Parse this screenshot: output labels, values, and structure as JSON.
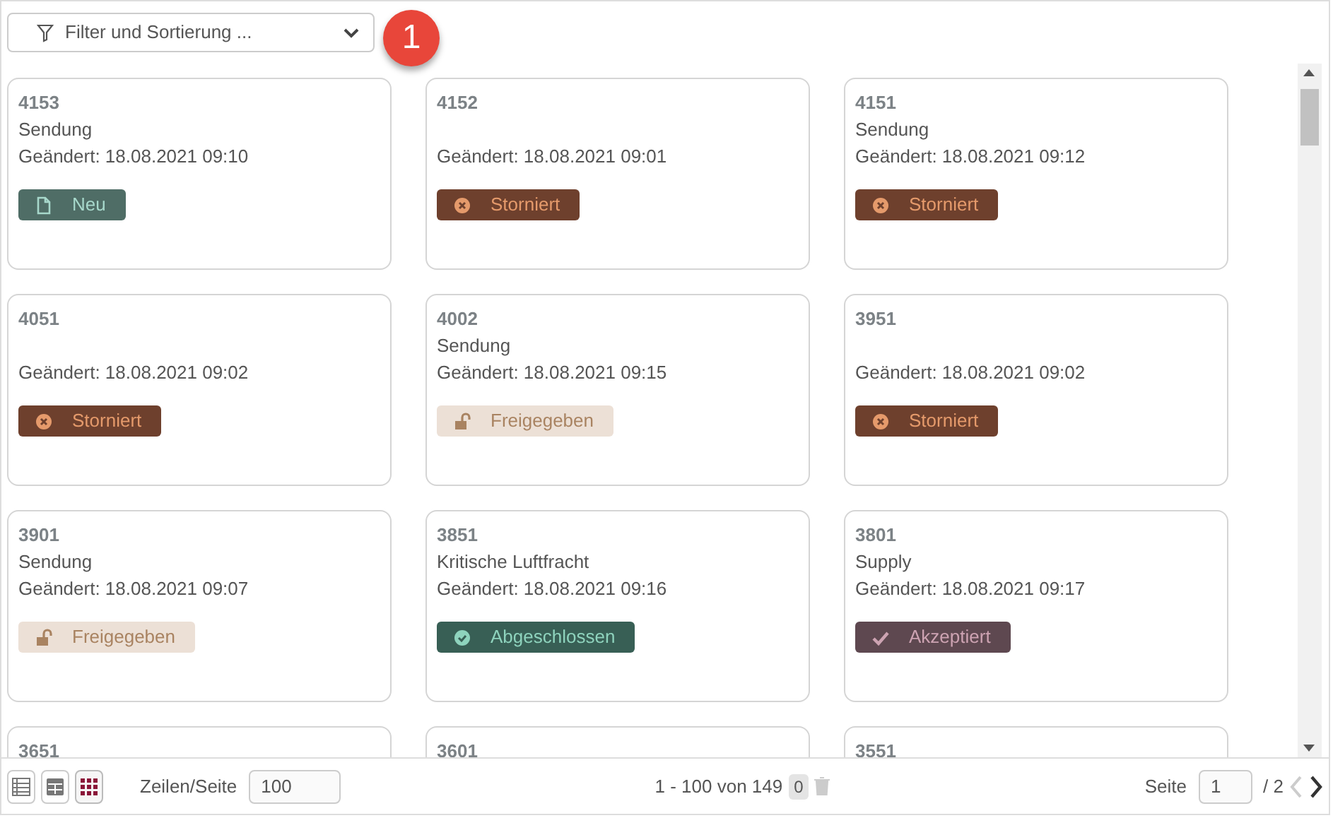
{
  "filter": {
    "label": "Filter und Sortierung ...",
    "badge": "1"
  },
  "cards": [
    {
      "number": "4153",
      "type": "Sendung",
      "changed": "Geändert: 18.08.2021 09:10",
      "status": {
        "kind": "new",
        "label": "Neu"
      }
    },
    {
      "number": "4152",
      "changed": "Geändert: 18.08.2021 09:01",
      "status": {
        "kind": "cancelled",
        "label": "Storniert"
      }
    },
    {
      "number": "4151",
      "type": "Sendung",
      "changed": "Geändert: 18.08.2021 09:12",
      "status": {
        "kind": "cancelled",
        "label": "Storniert"
      }
    },
    {
      "number": "4051",
      "changed": "Geändert: 18.08.2021 09:02",
      "status": {
        "kind": "cancelled",
        "label": "Storniert"
      }
    },
    {
      "number": "4002",
      "type": "Sendung",
      "changed": "Geändert: 18.08.2021 09:15",
      "status": {
        "kind": "released",
        "label": "Freigegeben"
      }
    },
    {
      "number": "3951",
      "changed": "Geändert: 18.08.2021 09:02",
      "status": {
        "kind": "cancelled",
        "label": "Storniert"
      }
    },
    {
      "number": "3901",
      "type": "Sendung",
      "changed": "Geändert: 18.08.2021 09:07",
      "status": {
        "kind": "released",
        "label": "Freigegeben"
      }
    },
    {
      "number": "3851",
      "type": "Kritische Luftfracht",
      "changed": "Geändert: 18.08.2021 09:16",
      "status": {
        "kind": "completed",
        "label": "Abgeschlossen"
      }
    },
    {
      "number": "3801",
      "type": "Supply",
      "changed": "Geändert: 18.08.2021 09:17",
      "status": {
        "kind": "accepted",
        "label": "Akzeptiert"
      }
    },
    {
      "number": "3651"
    },
    {
      "number": "3601"
    },
    {
      "number": "3551"
    }
  ],
  "footer": {
    "view_buttons": [
      {
        "kind": "list",
        "selected": false
      },
      {
        "kind": "table",
        "selected": false
      },
      {
        "kind": "grid",
        "selected": true
      }
    ],
    "rows_label": "Zeilen/Seite",
    "rows_value": "100",
    "range": "1 - 100 von 149",
    "selected_count": "0",
    "page_label": "Seite",
    "page_value": "1",
    "page_total": "/ 2"
  }
}
